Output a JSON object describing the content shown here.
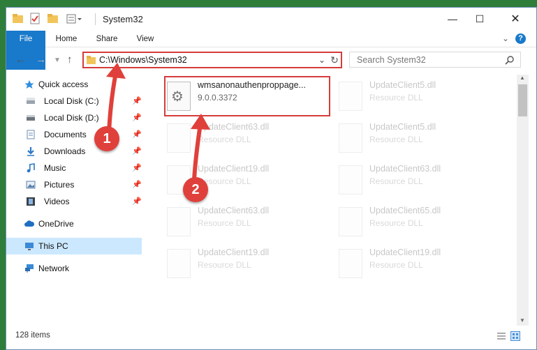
{
  "window": {
    "title": "System32",
    "controls": [
      "minimize",
      "maximize",
      "close"
    ]
  },
  "ribbon": {
    "tabs": [
      "File",
      "Home",
      "Share",
      "View"
    ]
  },
  "navbar": {
    "address": "C:\\Windows\\System32",
    "search_placeholder": "Search System32"
  },
  "sidebar": {
    "items": [
      {
        "label": "Quick access",
        "icon": "star-icon"
      },
      {
        "label": "Local Disk (C:)",
        "icon": "drive-icon",
        "pinned": true
      },
      {
        "label": "Local Disk (D:)",
        "icon": "drive-icon",
        "pinned": true
      },
      {
        "label": "Documents",
        "icon": "documents-icon",
        "pinned": true
      },
      {
        "label": "Downloads",
        "icon": "downloads-icon",
        "pinned": true
      },
      {
        "label": "Music",
        "icon": "music-icon",
        "pinned": true
      },
      {
        "label": "Pictures",
        "icon": "pictures-icon",
        "pinned": true
      },
      {
        "label": "Videos",
        "icon": "videos-icon",
        "pinned": true
      },
      {
        "label": "OneDrive",
        "icon": "cloud-icon"
      },
      {
        "label": "This PC",
        "icon": "computer-icon",
        "selected": true
      },
      {
        "label": "Network",
        "icon": "network-icon"
      }
    ]
  },
  "files": [
    {
      "name": "wmsanonauthenproppage...",
      "type": "9.0.0.3372",
      "highlighted": true
    },
    {
      "name": "UpdateClient5.dll",
      "type": "Resource DLL"
    },
    {
      "name": "UpdateClient63.dll",
      "type": "Resource DLL"
    },
    {
      "name": "UpdateClient5.dll",
      "type": "Resource DLL"
    },
    {
      "name": "UpdateClient19.dll",
      "type": "Resource DLL"
    },
    {
      "name": "UpdateClient63.dll",
      "type": "Resource DLL"
    },
    {
      "name": "UpdateClient63.dll",
      "type": "Resource DLL"
    },
    {
      "name": "UpdateClient65.dll",
      "type": "Resource DLL"
    },
    {
      "name": "UpdateClient19.dll",
      "type": "Resource DLL"
    },
    {
      "name": "UpdateClient19.dll",
      "type": "Resource DLL"
    }
  ],
  "status": {
    "item_count": "128 items"
  },
  "annotations": {
    "badge1": "1",
    "badge2": "2",
    "color": "#e0403b"
  },
  "colors": {
    "accent": "#1979ca",
    "highlight": "#d63b3b",
    "selected": "#cce8ff"
  }
}
